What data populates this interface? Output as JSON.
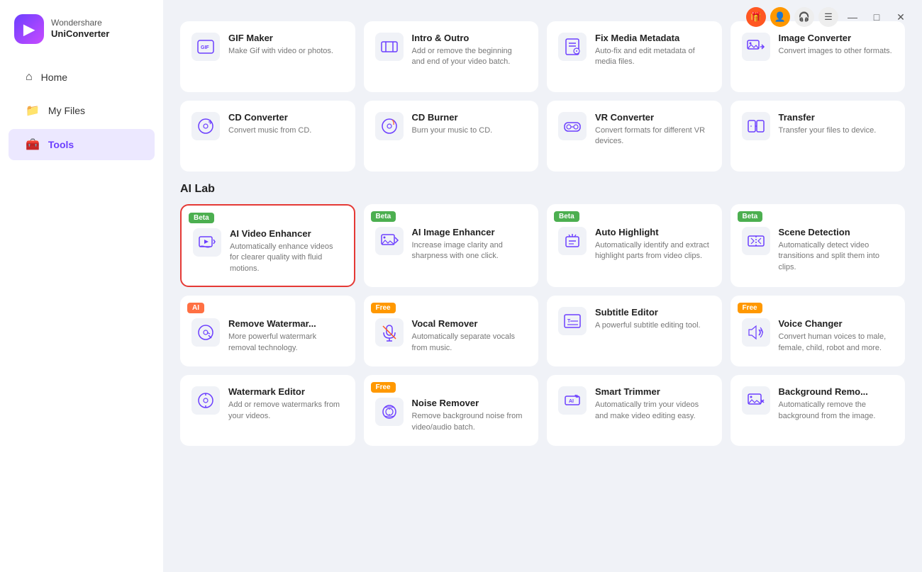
{
  "app": {
    "name": "Wondershare",
    "product": "UniConverter"
  },
  "topbar": {
    "gift_icon": "🎁",
    "user_icon": "👤",
    "headset_icon": "🎧",
    "menu_icon": "☰",
    "minimize": "—",
    "maximize": "□",
    "close": "✕"
  },
  "sidebar": {
    "items": [
      {
        "id": "home",
        "label": "Home",
        "icon": "⌂",
        "active": false
      },
      {
        "id": "my-files",
        "label": "My Files",
        "icon": "📁",
        "active": false
      },
      {
        "id": "tools",
        "label": "Tools",
        "icon": "🧰",
        "active": true
      }
    ]
  },
  "sections": [
    {
      "id": "tools",
      "cards": [
        {
          "id": "gif-maker",
          "title": "GIF Maker",
          "desc": "Make Gif with video or photos.",
          "badge": null,
          "icon": "gif"
        },
        {
          "id": "intro-outro",
          "title": "Intro & Outro",
          "desc": "Add or remove the beginning and end of your video batch.",
          "badge": null,
          "icon": "intro"
        },
        {
          "id": "fix-media-metadata",
          "title": "Fix Media Metadata",
          "desc": "Auto-fix and edit metadata of media files.",
          "badge": null,
          "icon": "metadata"
        },
        {
          "id": "image-converter",
          "title": "Image Converter",
          "desc": "Convert images to other formats.",
          "badge": null,
          "icon": "image-convert"
        },
        {
          "id": "cd-converter",
          "title": "CD Converter",
          "desc": "Convert music from CD.",
          "badge": null,
          "icon": "cd-convert"
        },
        {
          "id": "cd-burner",
          "title": "CD Burner",
          "desc": "Burn your music to CD.",
          "badge": null,
          "icon": "cd-burn"
        },
        {
          "id": "vr-converter",
          "title": "VR Converter",
          "desc": "Convert formats for different VR devices.",
          "badge": null,
          "icon": "vr"
        },
        {
          "id": "transfer",
          "title": "Transfer",
          "desc": "Transfer your files to device.",
          "badge": null,
          "icon": "transfer"
        }
      ]
    },
    {
      "id": "ai-lab",
      "title": "AI Lab",
      "cards": [
        {
          "id": "ai-video-enhancer",
          "title": "AI Video Enhancer",
          "desc": "Automatically enhance videos for clearer quality with fluid motions.",
          "badge": "Beta",
          "badgeType": "beta",
          "icon": "video-enhance",
          "selected": true
        },
        {
          "id": "ai-image-enhancer",
          "title": "AI Image Enhancer",
          "desc": "Increase image clarity and sharpness with one click.",
          "badge": "Beta",
          "badgeType": "beta",
          "icon": "image-enhance",
          "selected": false
        },
        {
          "id": "auto-highlight",
          "title": "Auto Highlight",
          "desc": "Automatically identify and extract highlight parts from video clips.",
          "badge": "Beta",
          "badgeType": "beta",
          "icon": "highlight",
          "selected": false
        },
        {
          "id": "scene-detection",
          "title": "Scene Detection",
          "desc": "Automatically detect video transitions and split them into clips.",
          "badge": "Beta",
          "badgeType": "beta",
          "icon": "scene",
          "selected": false
        },
        {
          "id": "remove-watermark",
          "title": "Remove Watermar...",
          "desc": "More powerful watermark removal technology.",
          "badge": "AI",
          "badgeType": "ai",
          "icon": "watermark-remove",
          "selected": false
        },
        {
          "id": "vocal-remover",
          "title": "Vocal Remover",
          "desc": "Automatically separate vocals from music.",
          "badge": "Free",
          "badgeType": "free",
          "icon": "vocal",
          "selected": false
        },
        {
          "id": "subtitle-editor",
          "title": "Subtitle Editor",
          "desc": "A powerful subtitle editing tool.",
          "badge": null,
          "icon": "subtitle",
          "selected": false
        },
        {
          "id": "voice-changer",
          "title": "Voice Changer",
          "desc": "Convert human voices to male, female, child, robot and more.",
          "badge": "Free",
          "badgeType": "free",
          "icon": "voice-change",
          "selected": false
        },
        {
          "id": "watermark-editor",
          "title": "Watermark Editor",
          "desc": "Add or remove watermarks from your videos.",
          "badge": null,
          "icon": "watermark-edit",
          "selected": false
        },
        {
          "id": "noise-remover",
          "title": "Noise Remover",
          "desc": "Remove background noise from video/audio batch.",
          "badge": "Free",
          "badgeType": "free",
          "icon": "noise",
          "selected": false
        },
        {
          "id": "smart-trimmer",
          "title": "Smart Trimmer",
          "desc": "Automatically trim your videos and make video editing easy.",
          "badge": null,
          "icon": "smart-trim",
          "selected": false
        },
        {
          "id": "background-remover",
          "title": "Background Remo...",
          "desc": "Automatically remove the background from the image.",
          "badge": null,
          "icon": "bg-remove",
          "selected": false
        }
      ]
    }
  ]
}
